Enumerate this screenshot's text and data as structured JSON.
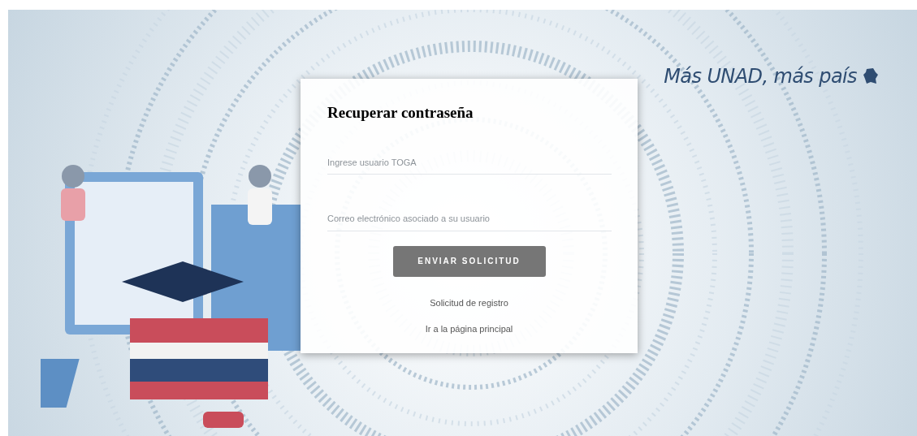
{
  "slogan": "Más UNAD, más país",
  "form": {
    "title": "Recuperar contraseña",
    "fields": [
      {
        "placeholder": "Ingrese usuario TOGA"
      },
      {
        "placeholder": "Correo electrónico asociado a su usuario"
      }
    ],
    "submit": "ENVIAR SOLICITUD",
    "links": [
      "Solicitud de registro",
      "Ir a la página principal"
    ]
  }
}
